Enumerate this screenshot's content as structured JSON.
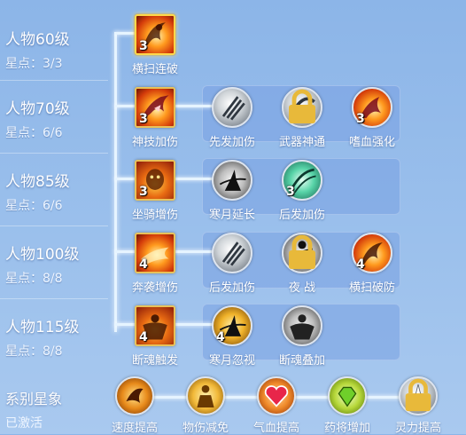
{
  "tiers": [
    {
      "level": "人物60级",
      "stars": "星点：3/3",
      "skills": [
        {
          "name": "横扫连破",
          "level": "3",
          "icon": "sweep-slash-icon",
          "locked": false
        }
      ]
    },
    {
      "level": "人物70级",
      "stars": "星点：6/6",
      "skills": [
        {
          "name": "神技加伤",
          "level": "3",
          "icon": "divine-claw-icon",
          "locked": false
        },
        {
          "name": "先发加伤",
          "level": "",
          "icon": "triple-blade-icon",
          "locked": false
        },
        {
          "name": "武器神通",
          "level": "",
          "icon": "weapon-spin-icon",
          "locked": true
        },
        {
          "name": "嗜血强化",
          "level": "3",
          "icon": "bloodthirst-claw-icon",
          "locked": false
        }
      ]
    },
    {
      "level": "人物85级",
      "stars": "星点：6/6",
      "skills": [
        {
          "name": "坐骑增伤",
          "level": "3",
          "icon": "mount-beast-icon",
          "locked": false
        },
        {
          "name": "寒月延长",
          "level": "",
          "icon": "cold-moon-icon",
          "locked": false
        },
        {
          "name": "后发加伤",
          "level": "3",
          "icon": "swift-slash-icon",
          "locked": false
        }
      ]
    },
    {
      "level": "人物100级",
      "stars": "星点：8/8",
      "skills": [
        {
          "name": "奔袭增伤",
          "level": "4",
          "icon": "charge-flame-icon",
          "locked": false
        },
        {
          "name": "后发加伤",
          "level": "",
          "icon": "triple-blade-icon",
          "locked": false
        },
        {
          "name": "夜 战",
          "level": "",
          "icon": "night-warrior-icon",
          "locked": true
        },
        {
          "name": "横扫破防",
          "level": "4",
          "icon": "sweep-break-icon",
          "locked": false
        }
      ]
    },
    {
      "level": "人物115级",
      "stars": "星点：8/8",
      "skills": [
        {
          "name": "断魂触发",
          "level": "4",
          "icon": "soul-burst-icon",
          "locked": false
        },
        {
          "name": "寒月忽视",
          "level": "4",
          "icon": "cold-moon-icon",
          "locked": false
        },
        {
          "name": "断魂叠加",
          "level": "",
          "icon": "soul-stack-icon",
          "locked": false
        }
      ]
    }
  ],
  "constellation": {
    "title": "系别星象",
    "status": "已激活",
    "items": [
      {
        "name": "速度提高",
        "icon": "speed-rune-icon",
        "locked": false
      },
      {
        "name": "物伤减免",
        "icon": "guard-figure-icon",
        "locked": false
      },
      {
        "name": "气血提高",
        "icon": "heart-icon",
        "locked": false
      },
      {
        "name": "药将增加",
        "icon": "gem-icon",
        "locked": false
      },
      {
        "name": "灵力提高",
        "icon": "spirit-burst-icon",
        "locked": true
      }
    ]
  },
  "colors": {
    "background": "#8cb5e8",
    "connector": "#e6f4ff",
    "selected_border": "#ffd84a",
    "skill_border": "#e8c25a"
  }
}
